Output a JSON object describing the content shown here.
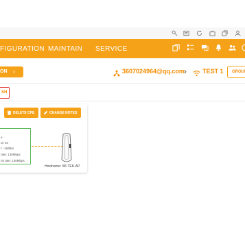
{
  "browser_toolbar": {
    "icons": [
      "key-icon",
      "reader-icon",
      "refresh-icon",
      "puzzle-icon",
      "collections-icon",
      "profile-icon"
    ]
  },
  "nav": {
    "items": [
      "FIGURATION",
      "MAINTAIN",
      "SERVICE"
    ],
    "icons": [
      "copy-icon",
      "list-icon",
      "chat-icon",
      "bell-icon",
      "users-icon",
      "user-icon"
    ],
    "bg_color": "#f6a219"
  },
  "subbar": {
    "left_button": "ON",
    "account": "3607024964@qq.com",
    "network": "TEST 1",
    "group_button": "GROUP"
  },
  "actions": {
    "refresh": "SH",
    "delete_cpe": "DELETE CPE",
    "change_notes": "CHANGE NOTES"
  },
  "device_info": {
    "lines": [
      "e",
      "ol: 40",
      "l: -16dBm",
      "rate: 130Mbps",
      "nit rate: 130Mbps"
    ],
    "hostname": "Hostname: WI-TEK-AP"
  }
}
